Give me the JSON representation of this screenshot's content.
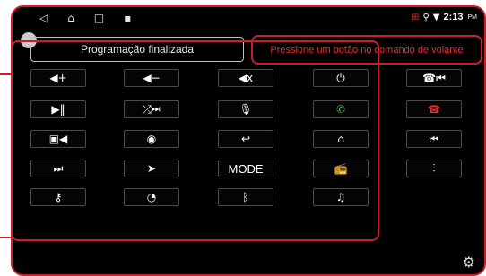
{
  "status_bar": {
    "nav_icons": [
      "◁",
      "⌂",
      "□"
    ],
    "app_icon": "▪",
    "right_icons": [
      "⊞",
      "⚲",
      "▼"
    ],
    "time": "2:13",
    "ampm": "PM"
  },
  "header": {
    "title": "Programação finalizada",
    "message": "Pressione um botão no comando de volante"
  },
  "colors": {
    "accent": "#c8202a",
    "call_green": "#2fbf3f",
    "hangup_red": "#d83232"
  },
  "grid": {
    "volume_up": {
      "icon": "volume-up-icon",
      "glyph": "◀+"
    },
    "volume_down": {
      "icon": "volume-down-icon",
      "glyph": "◀−"
    },
    "mute": {
      "icon": "mute-icon",
      "glyph": "◀x"
    },
    "power": {
      "icon": "power-icon",
      "glyph": "⏻"
    },
    "call_prev": {
      "icon": "call-previous-icon",
      "glyph": "☎⏮"
    },
    "play_pause": {
      "icon": "play-pause-icon",
      "glyph": "▶‖"
    },
    "shuffle_next": {
      "icon": "shuffle-next-icon",
      "glyph": "⤮⏭"
    },
    "mic": {
      "icon": "microphone-icon",
      "glyph": "🎙"
    },
    "call_answer": {
      "icon": "call-answer-icon",
      "glyph": "✆"
    },
    "call_hangup": {
      "icon": "call-hangup-icon",
      "glyph": "☎"
    },
    "car_view": {
      "icon": "car-camera-icon",
      "glyph": "▣◀"
    },
    "camera_360": {
      "icon": "camera-360-icon",
      "glyph": "◉"
    },
    "back": {
      "icon": "back-icon",
      "glyph": "↩"
    },
    "home": {
      "icon": "home-icon",
      "glyph": "⌂"
    },
    "previous": {
      "icon": "previous-track-icon",
      "glyph": "⏮"
    },
    "next": {
      "icon": "next-track-icon",
      "glyph": "⏭"
    },
    "navigation": {
      "icon": "navigation-icon",
      "glyph": "➤"
    },
    "mode": {
      "label": "MODE"
    },
    "radio": {
      "icon": "radio-icon",
      "glyph": "📻"
    },
    "equalizer": {
      "icon": "equalizer-icon",
      "glyph": "⫶"
    },
    "key": {
      "icon": "key-icon",
      "glyph": "⚷"
    },
    "dial": {
      "icon": "dial-icon",
      "glyph": "◔"
    },
    "bluetooth": {
      "icon": "bluetooth-icon",
      "glyph": "ᛒ"
    },
    "music": {
      "icon": "music-icon",
      "glyph": "♫"
    }
  }
}
